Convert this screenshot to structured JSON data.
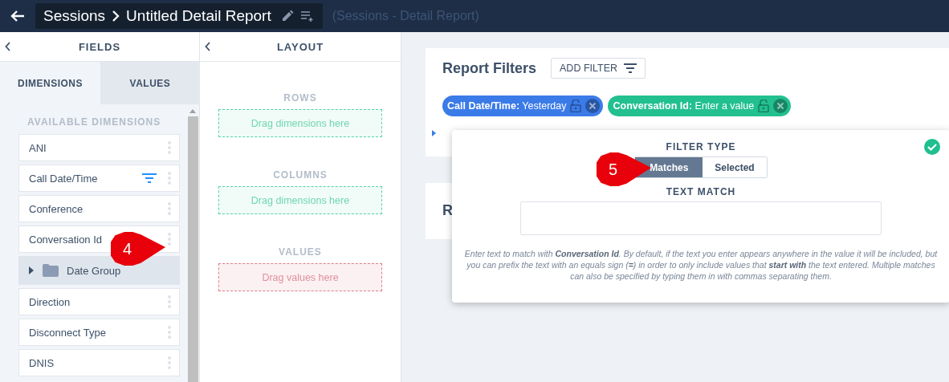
{
  "header": {
    "breadcrumb": [
      "Sessions",
      "Untitled Detail Report"
    ],
    "subtitle": "(Sessions - Detail Report)"
  },
  "fields_panel": {
    "title": "FIELDS",
    "tabs": [
      {
        "label": "DIMENSIONS",
        "selected": true
      },
      {
        "label": "VALUES",
        "selected": false
      }
    ],
    "section_title": "AVAILABLE DIMENSIONS",
    "items": [
      {
        "kind": "field",
        "label": "ANI",
        "filtered": false
      },
      {
        "kind": "field",
        "label": "Call Date/Time",
        "filtered": true
      },
      {
        "kind": "field",
        "label": "Conference",
        "filtered": false
      },
      {
        "kind": "field",
        "label": "Conversation Id",
        "filtered": false
      },
      {
        "kind": "group",
        "label": "Date Group",
        "expanded": false
      },
      {
        "kind": "field",
        "label": "Direction",
        "filtered": false
      },
      {
        "kind": "field",
        "label": "Disconnect Type",
        "filtered": false
      },
      {
        "kind": "field",
        "label": "DNIS",
        "filtered": false
      }
    ]
  },
  "layout_panel": {
    "title": "LAYOUT",
    "sections": [
      {
        "kind": "dimension",
        "title": "ROWS",
        "hint": "Drag dimensions here"
      },
      {
        "kind": "dimension",
        "title": "COLUMNS",
        "hint": "Drag dimensions here"
      },
      {
        "kind": "value",
        "title": "VALUES",
        "hint": "Drag values here"
      }
    ]
  },
  "report_filters": {
    "title": "Report Filters",
    "add_button": "ADD FILTER",
    "chips": [
      {
        "name": "Call Date/Time:",
        "value": "Yesterday",
        "color": "#3b7be8"
      },
      {
        "name": "Conversation Id:",
        "value": "Enter a value",
        "color": "#22c08f"
      }
    ]
  },
  "second_card": {
    "title": "R"
  },
  "filter_popover": {
    "filter_type_label": "FILTER TYPE",
    "types": [
      {
        "label": "Matches",
        "selected": true
      },
      {
        "label": "Selected",
        "selected": false
      }
    ],
    "text_match_label": "TEXT MATCH",
    "help": "Enter text to match with **Conversation Id**. By default, if the text you enter appears anywhere in the value it will be included, but you can prefix the text with an equals sign (**=**) in order to only include values that **start with** the text entered. Multiple matches can also be specified by typing them in with commas separating them."
  },
  "callouts": [
    {
      "number": "4"
    },
    {
      "number": "5"
    }
  ]
}
